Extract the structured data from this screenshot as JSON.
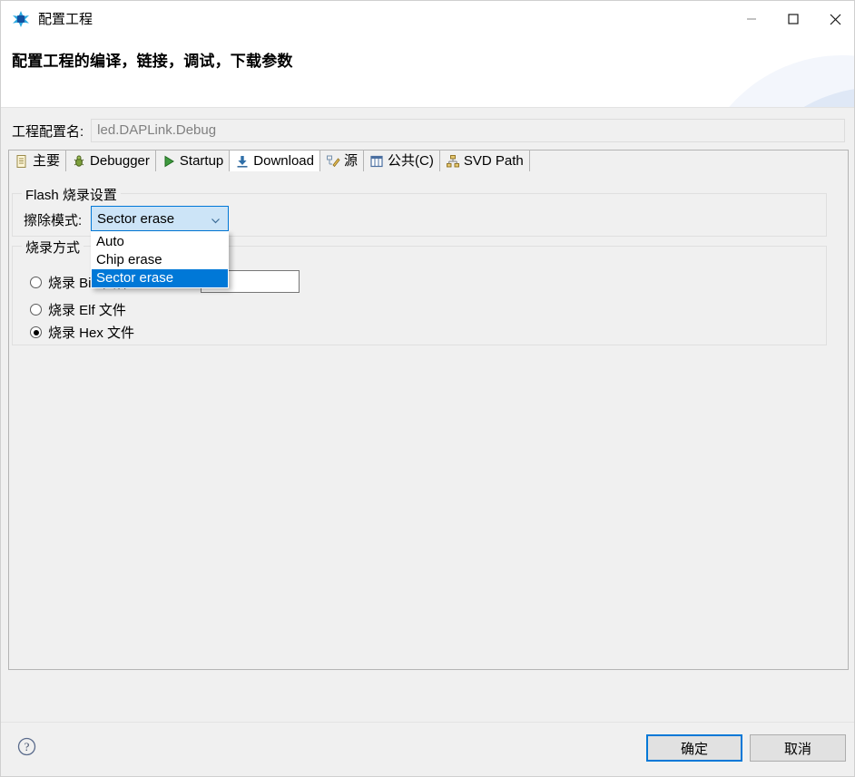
{
  "window": {
    "icon": "project-star-icon",
    "title": "配置工程",
    "minimize_label": "minimize-icon",
    "maximize_label": "maximize-icon",
    "close_label": "close-icon"
  },
  "header": {
    "title": "配置工程的编译，链接，调试，下载参数"
  },
  "config_name": {
    "label": "工程配置名:",
    "value": "led.DAPLink.Debug",
    "placeholder": "led.DAPLink.Debug"
  },
  "tabs": [
    {
      "label": "主要",
      "icon": "document-icon",
      "active": false
    },
    {
      "label": "Debugger",
      "icon": "bug-icon",
      "active": false
    },
    {
      "label": "Startup",
      "icon": "play-icon",
      "active": false
    },
    {
      "label": "Download",
      "icon": "download-icon",
      "active": true
    },
    {
      "label": "源",
      "icon": "source-icon",
      "active": false
    },
    {
      "label": "公共(C)",
      "icon": "common-icon",
      "active": false
    },
    {
      "label": "SVD Path",
      "icon": "tree-icon",
      "active": false
    }
  ],
  "flash_group": {
    "title": "Flash 烧录设置",
    "erase_label": "擦除模式:",
    "combo": {
      "selected": "Sector erase",
      "arrow_icon": "chevron-down-icon",
      "options": [
        "Auto",
        "Chip erase",
        "Sector erase"
      ],
      "open": true,
      "highlighted": "Sector erase"
    }
  },
  "method_group": {
    "title": "烧录方式",
    "options": [
      {
        "label": "烧录 Bin 文件",
        "checked": false
      },
      {
        "label": "烧录 Elf 文件",
        "checked": false
      },
      {
        "label": "烧录 Hex 文件",
        "checked": true
      }
    ],
    "bin_address": {
      "value": "",
      "placeholder": ""
    }
  },
  "footer": {
    "help_icon": "help-question-icon",
    "ok_label": "确定",
    "cancel_label": "取消"
  },
  "colors": {
    "accent": "#0078d7",
    "combo_fill": "#cce4f7",
    "panel_bg": "#f0f0f0",
    "banner_bg": "#ffffff"
  }
}
